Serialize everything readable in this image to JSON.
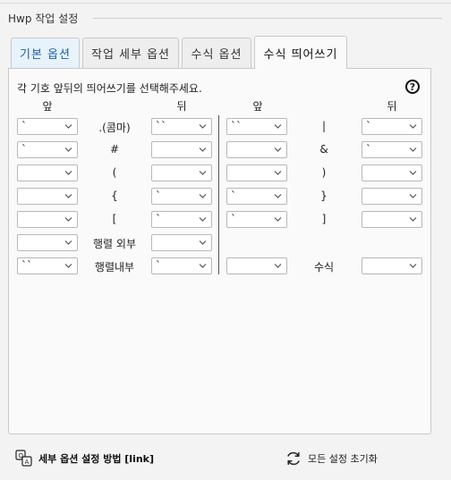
{
  "window": {
    "group_title": "Hwp 작업 설정"
  },
  "tabs": [
    {
      "label": "기본 옵션"
    },
    {
      "label": "작업 세부 옵션"
    },
    {
      "label": "수식 옵션"
    },
    {
      "label": "수식 띄어쓰기"
    }
  ],
  "panel": {
    "instruction": "각 기호 앞뒤의 띄어쓰기를 선택해주세요.",
    "help_symbol": "?",
    "headers": {
      "left_before": "앞",
      "left_after": "뒤",
      "right_before": "앞",
      "right_after": "뒤"
    },
    "left_rows": [
      {
        "before": "`",
        "symbol": ".(콤마)",
        "after": "``"
      },
      {
        "before": "`",
        "symbol": "#",
        "after": ""
      },
      {
        "before": "",
        "symbol": "(",
        "after": ""
      },
      {
        "before": "",
        "symbol": "{",
        "after": "`"
      },
      {
        "before": "",
        "symbol": "[",
        "after": "`"
      },
      {
        "before": "",
        "symbol": "행렬 외부",
        "after": ""
      },
      {
        "before": "``",
        "symbol": "행렬내부",
        "after": "`"
      }
    ],
    "right_rows": [
      {
        "before": "``",
        "symbol": "|",
        "after": "`"
      },
      {
        "before": "",
        "symbol": "&",
        "after": "`"
      },
      {
        "before": "",
        "symbol": ")",
        "after": ""
      },
      {
        "before": "`",
        "symbol": "}",
        "after": ""
      },
      {
        "before": "`",
        "symbol": "]",
        "after": ""
      },
      {
        "before": "",
        "symbol": "수식",
        "after": ""
      }
    ]
  },
  "footer": {
    "help_link": "세부 옵션 설정 방법 [link]",
    "reset_button": "모든 설정 초기화"
  }
}
